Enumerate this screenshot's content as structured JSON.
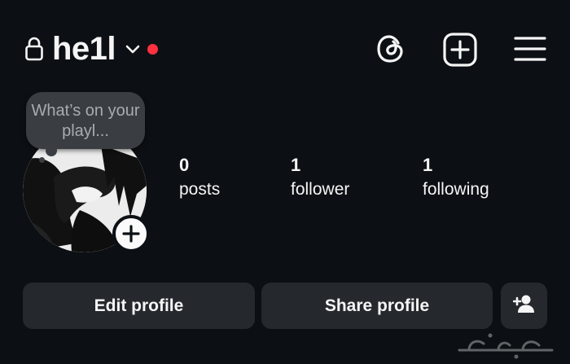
{
  "header": {
    "username": "he1l",
    "icons": {
      "lock": "lock-icon",
      "chevron": "chevron-down-icon",
      "threads": "threads-icon",
      "add": "add-post-icon",
      "menu": "hamburger-menu-icon"
    },
    "notification_dot_color": "#ff3040"
  },
  "profile": {
    "note_text": "What’s on your playl...",
    "stats": [
      {
        "value": "0",
        "label": "posts"
      },
      {
        "value": "1",
        "label": "follower"
      },
      {
        "value": "1",
        "label": "following"
      }
    ]
  },
  "actions": {
    "edit_label": "Edit profile",
    "share_label": "Share profile",
    "discover_icon": "add-person-icon"
  },
  "watermark": {
    "icon": "haraj-logo"
  }
}
